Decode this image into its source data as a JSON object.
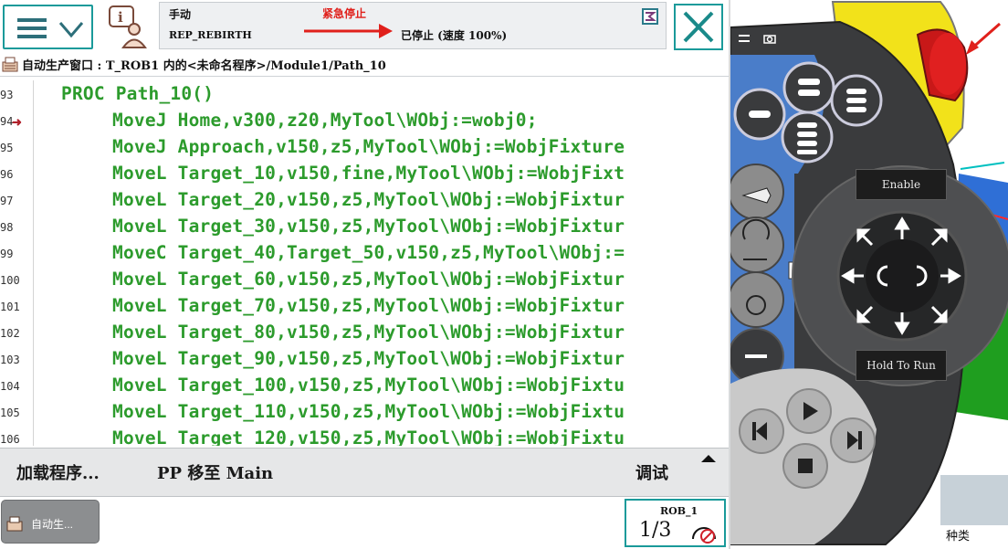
{
  "header": {
    "mode": "手动",
    "task": "REP_REBIRTH",
    "estop": "紧急停止",
    "state": "已停止 (速度 100%)"
  },
  "breadcrumb": {
    "text": "自动生产窗口 : T_ROB1 内的<未命名程序>/Module1/Path_10"
  },
  "code": {
    "pc_line": "94",
    "lines": [
      {
        "no": "93",
        "text": "PROC Path_10()",
        "indent": 0
      },
      {
        "no": "",
        "text": "MoveJ Home,v300,z20,MyTool\\WObj:=wobj0;",
        "indent": 1
      },
      {
        "no": "95",
        "text": "MoveJ Approach,v150,z5,MyTool\\WObj:=WobjFixture",
        "indent": 1
      },
      {
        "no": "96",
        "text": "MoveL Target_10,v150,fine,MyTool\\WObj:=WobjFixt",
        "indent": 1
      },
      {
        "no": "97",
        "text": "MoveL Target_20,v150,z5,MyTool\\WObj:=WobjFixtur",
        "indent": 1
      },
      {
        "no": "98",
        "text": "MoveL Target_30,v150,z5,MyTool\\WObj:=WobjFixtur",
        "indent": 1
      },
      {
        "no": "99",
        "text": "MoveC Target_40,Target_50,v150,z5,MyTool\\WObj:=",
        "indent": 1
      },
      {
        "no": "100",
        "text": "MoveL Target_60,v150,z5,MyTool\\WObj:=WobjFixtur",
        "indent": 1
      },
      {
        "no": "101",
        "text": "MoveL Target_70,v150,z5,MyTool\\WObj:=WobjFixtur",
        "indent": 1
      },
      {
        "no": "102",
        "text": "MoveL Target_80,v150,z5,MyTool\\WObj:=WobjFixtur",
        "indent": 1
      },
      {
        "no": "103",
        "text": "MoveL Target_90,v150,z5,MyTool\\WObj:=WobjFixtur",
        "indent": 1
      },
      {
        "no": "104",
        "text": "MoveL Target_100,v150,z5,MyTool\\WObj:=WobjFixtu",
        "indent": 1
      },
      {
        "no": "105",
        "text": "MoveL Target_110,v150,z5,MyTool\\WObj:=WobjFixtu",
        "indent": 1
      },
      {
        "no": "106",
        "text": "MoveL Target_120,v150,z5,MyTool\\WObj:=WobjFixtu",
        "indent": 1
      }
    ]
  },
  "actions": {
    "load_program": "加载程序...",
    "pp_to_main": "PP 移至 Main",
    "debug": "调试"
  },
  "taskbar": {
    "tab_label": "自动生...",
    "rob": "ROB_1",
    "fraction": "1/3"
  },
  "pendant": {
    "enable": "Enable",
    "hold_to_run": "Hold To Run"
  },
  "background": {
    "kind_label": "种类"
  },
  "colors": {
    "code_green": "#2c9b2c",
    "accent_teal": "#1a9a9a",
    "estop_red": "#e0201b",
    "pendant_blue": "#4a7dc9"
  }
}
